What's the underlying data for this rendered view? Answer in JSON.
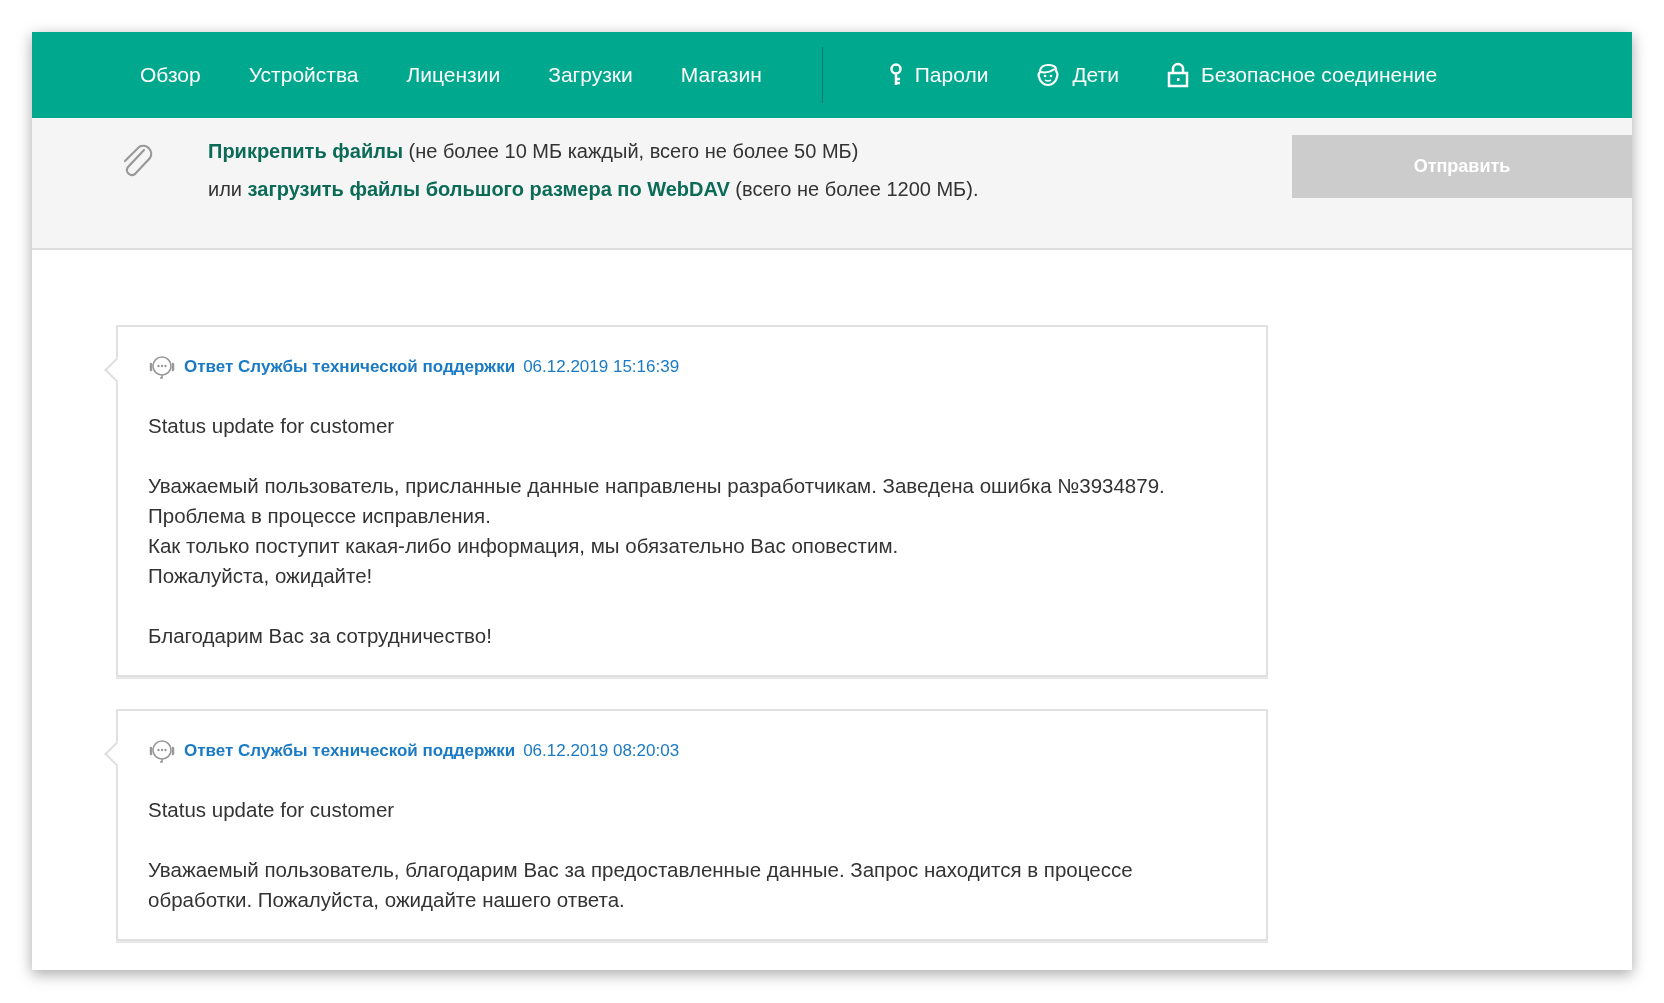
{
  "nav": {
    "items": [
      {
        "label": "Обзор"
      },
      {
        "label": "Устройства"
      },
      {
        "label": "Лицензии"
      },
      {
        "label": "Загрузки"
      },
      {
        "label": "Магазин"
      }
    ],
    "secondary_items": [
      {
        "label": "Пароли"
      },
      {
        "label": "Дети"
      },
      {
        "label": "Безопасное соединение"
      }
    ]
  },
  "attach": {
    "lines": [
      [
        {
          "kind": "link",
          "text": "Прикрепить файлы"
        },
        {
          "kind": "text",
          "text": "(не более 10 МБ каждый, всего не более 50 МБ)"
        }
      ],
      [
        {
          "kind": "text",
          "text": "или"
        },
        {
          "kind": "link",
          "text": "загрузить файлы большого размера по WebDAV"
        },
        {
          "kind": "text",
          "text": "(всего не более 1200 МБ)."
        }
      ]
    ],
    "send_button": {
      "label": "Отправить",
      "disabled": true
    }
  },
  "messages": [
    {
      "author": "Ответ Службы технической поддержки",
      "date": "06.12.2019 15:16:39",
      "paragraphs": [
        [
          "Status update for customer"
        ],
        [
          "Уважаемый пользователь, присланные данные направлены разработчикам. Заведена ошибка №3934879.",
          "Проблема в процессе исправления.",
          "Как только поступит какая-либо информация, мы обязательно Вас оповестим.",
          "Пожалуйста, ожидайте!"
        ],
        [
          "Благодарим Вас за сотрудничество!"
        ]
      ]
    },
    {
      "author": "Ответ Службы технической поддержки",
      "date": "06.12.2019 08:20:03",
      "paragraphs": [
        [
          "Status update for customer"
        ],
        [
          "Уважаемый пользователь, благодарим Вас за предоставленные данные. Запрос находится в процессе",
          "обработки. Пожалуйста, ожидайте нашего ответа."
        ]
      ]
    }
  ]
}
